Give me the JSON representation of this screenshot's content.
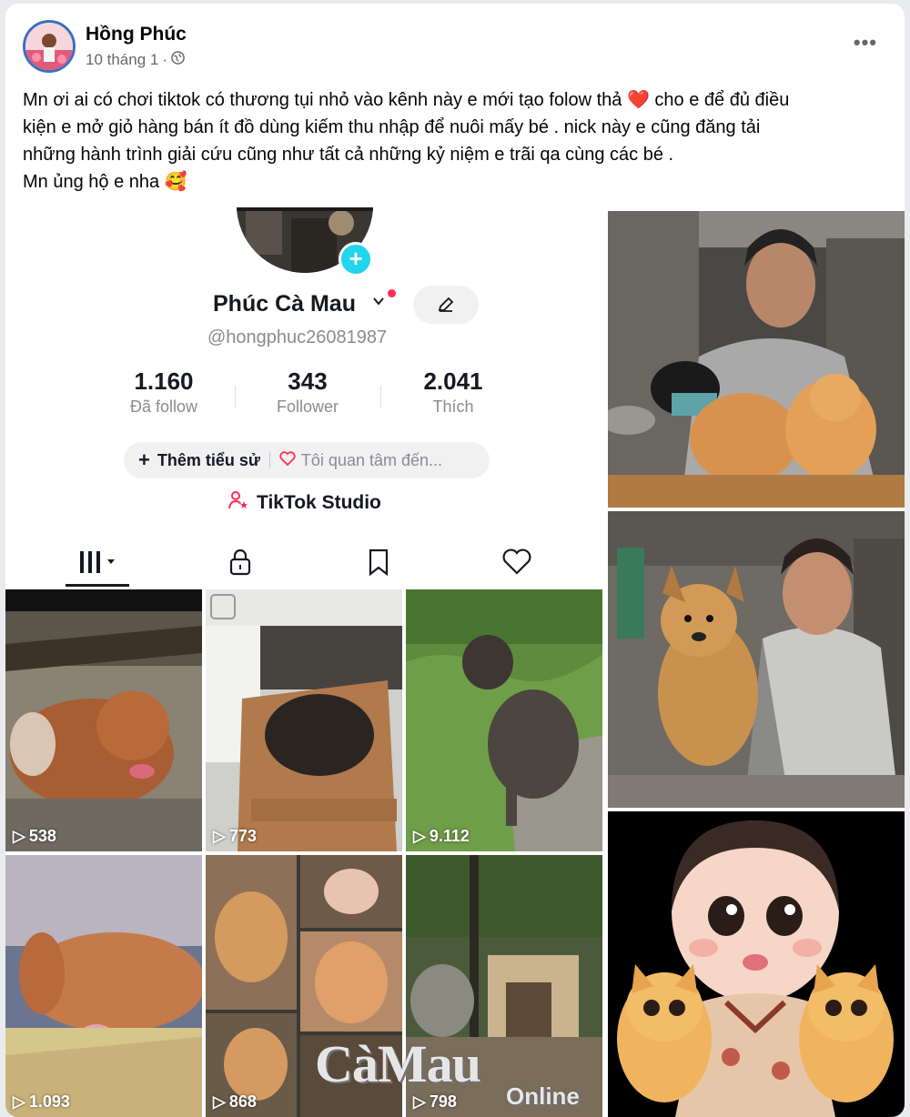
{
  "post": {
    "author": "Hồng Phúc",
    "date": "10 tháng 1",
    "separator": "·",
    "caption_lines": [
      "Mn ơi ai có chơi tiktok có thương tụi nhỏ vào kênh này e mới tạo folow thả ❤️ cho e để đủ điều",
      "kiện e mở giỏ hàng bán ít đồ dùng kiếm thu nhập để nuôi mấy bé . nick này e cũng đăng tải",
      "những hành trình giải cứu cũng như  tất cả những kỷ niệm e trãi qa cùng các bé .",
      "Mn ủng hộ e nha 🥰"
    ]
  },
  "tiktok": {
    "name": "Phúc Cà Mau",
    "handle": "@hongphuc26081987",
    "stats": [
      {
        "value": "1.160",
        "label": "Đã follow"
      },
      {
        "value": "343",
        "label": "Follower"
      },
      {
        "value": "2.041",
        "label": "Thích"
      }
    ],
    "bio_add": "Thêm tiểu sử",
    "interest": "Tôi quan tâm đến...",
    "studio": "TikTok Studio",
    "videos": [
      {
        "views": "538"
      },
      {
        "views": "773"
      },
      {
        "views": "9.112"
      },
      {
        "views": "1.093"
      },
      {
        "views": "868"
      },
      {
        "views": "798"
      }
    ]
  },
  "watermark": {
    "main": "CàMau",
    "sub": "Online"
  },
  "colors": {
    "accent_pink": "#fe2c55",
    "accent_cyan": "#20d5ec",
    "meta_gray": "#65676b"
  }
}
